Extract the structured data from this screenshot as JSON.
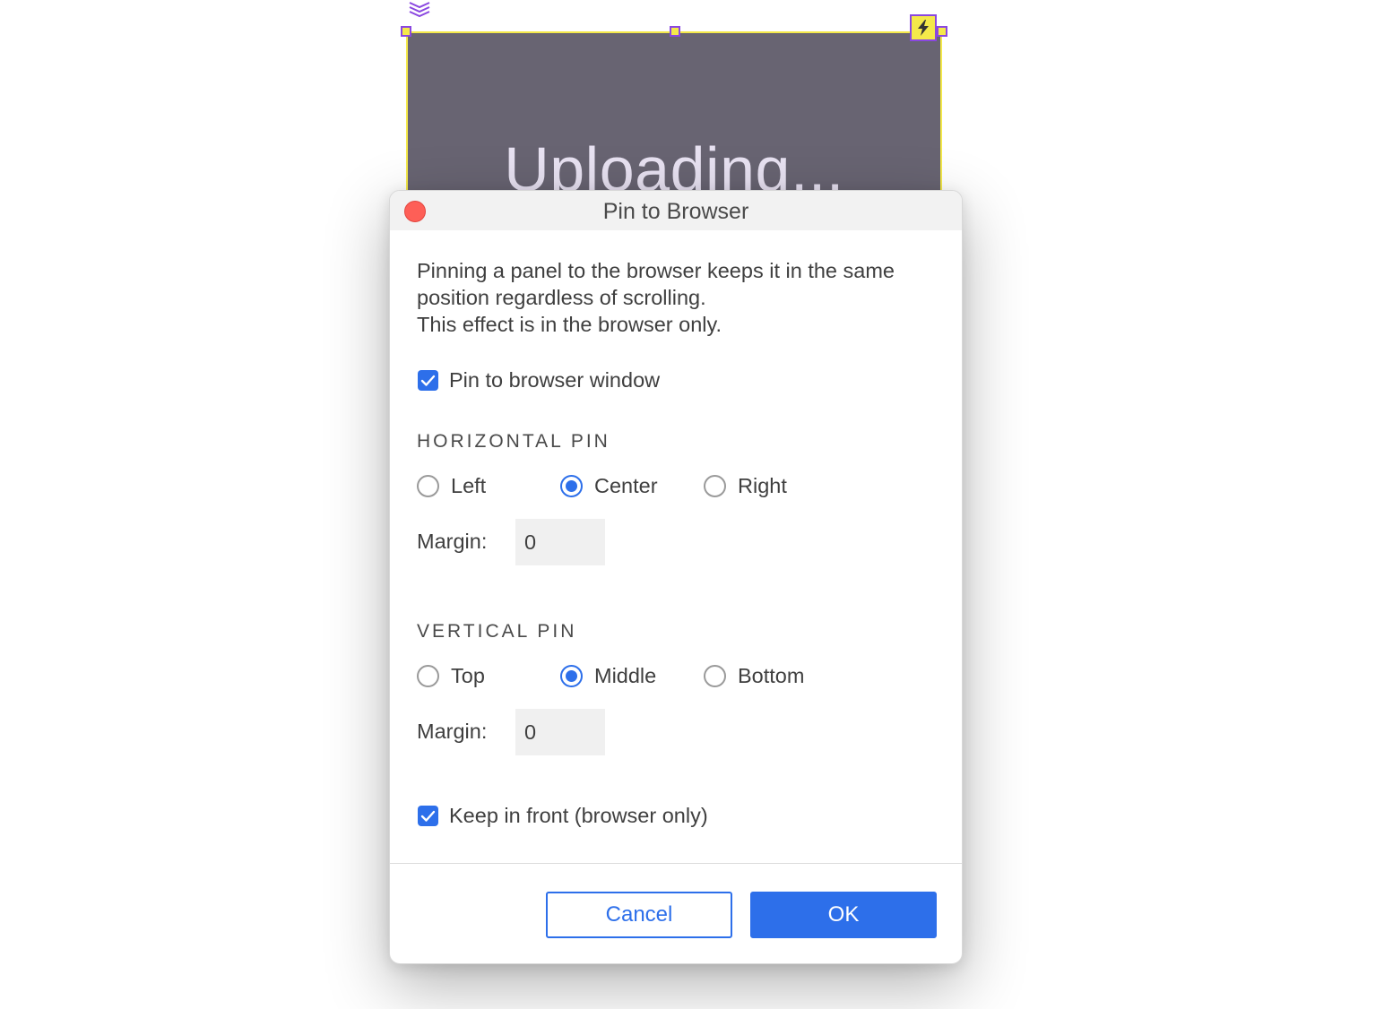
{
  "canvas": {
    "panel_text": "Uploading...",
    "panel_color": "#686472",
    "selection_color": "#f4e94a",
    "handle_border_color": "#8a47e0"
  },
  "dialog": {
    "title": "Pin to Browser",
    "description": [
      "Pinning a panel to the browser keeps it in the same",
      "position regardless of scrolling.",
      "This effect is in the browser only."
    ],
    "pin_checkbox": {
      "label": "Pin to browser window",
      "checked": true
    },
    "horizontal": {
      "title": "HORIZONTAL PIN",
      "options": [
        "Left",
        "Center",
        "Right"
      ],
      "selected": "Center",
      "margin_label": "Margin:",
      "margin_value": "0"
    },
    "vertical": {
      "title": "VERTICAL PIN",
      "options": [
        "Top",
        "Middle",
        "Bottom"
      ],
      "selected": "Middle",
      "margin_label": "Margin:",
      "margin_value": "0"
    },
    "keep_front_checkbox": {
      "label": "Keep in front (browser only)",
      "checked": true
    },
    "buttons": {
      "cancel": "Cancel",
      "ok": "OK"
    },
    "accent_color": "#2d6fea"
  }
}
